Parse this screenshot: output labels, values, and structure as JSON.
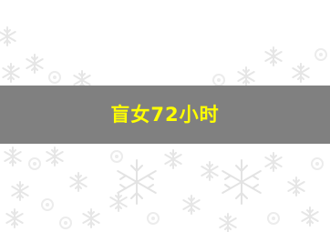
{
  "banner": {
    "title": "盲女72小时"
  },
  "colors": {
    "banner_background": "#808080",
    "title_text": "#ffff00",
    "page_background": "#ffffff",
    "snowflake_pattern": "#e9e9e9"
  },
  "background": {
    "pattern_icon": "snowflake-icon"
  }
}
